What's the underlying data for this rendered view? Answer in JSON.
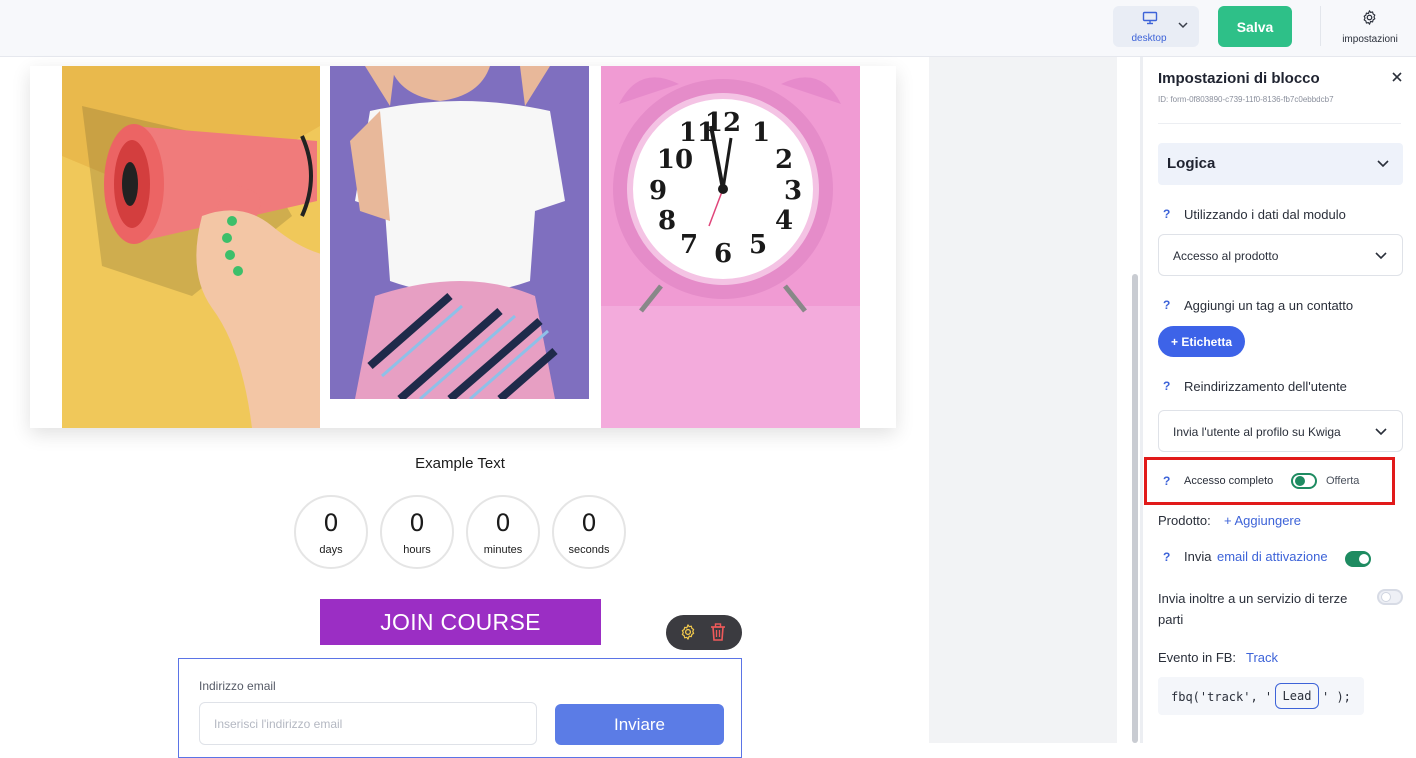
{
  "topbar": {
    "device_label": "desktop",
    "save_label": "Salva",
    "settings_label": "impostazioni"
  },
  "canvas": {
    "example_text": "Example Text",
    "countdown": [
      {
        "value": "0",
        "unit": "days"
      },
      {
        "value": "0",
        "unit": "hours"
      },
      {
        "value": "0",
        "unit": "minutes"
      },
      {
        "value": "0",
        "unit": "seconds"
      }
    ],
    "join_button": "JOIN COURSE",
    "form": {
      "email_label": "Indirizzo email",
      "email_placeholder": "Inserisci l'indirizzo email",
      "submit_label": "Inviare"
    }
  },
  "panel": {
    "title": "Impostazioni di blocco",
    "block_id": "ID: form-0f803890-c739-11f0-8136-fb7c0ebbdcb7",
    "section_title": "Logica",
    "help_mark": "?",
    "use_form_data_label": "Utilizzando i dati dal modulo",
    "use_form_data_value": "Accesso al prodotto",
    "add_tag_label": "Aggiungi un tag a un contatto",
    "tag_button": "+ Etichetta",
    "redirect_label": "Reindirizzamento dell'utente",
    "redirect_value": "Invia l'utente al profilo su Kwiga",
    "full_access_label": "Accesso completo",
    "full_access_option": "Offerta",
    "product_label": "Prodotto:",
    "product_add_link": "+ Aggiungere",
    "send_label_prefix": "Invia",
    "send_link": "email di attivazione",
    "third_party_label": "Invia inoltre a un servizio di terze parti",
    "fb_event_label": "Evento in FB:",
    "fb_event_link": "Track",
    "code_prefix": "fbq('track', '",
    "code_value": "Lead",
    "code_suffix": "' );"
  },
  "colors": {
    "accent_blue": "#3d63d8",
    "save_green": "#2ec088",
    "join_purple": "#9b2ec4",
    "toggle_green": "#1e8b61",
    "highlight_red": "#e11a1a"
  },
  "icons": [
    "monitor-icon",
    "chevron-down-icon",
    "gear-icon",
    "close-icon",
    "trash-icon"
  ]
}
